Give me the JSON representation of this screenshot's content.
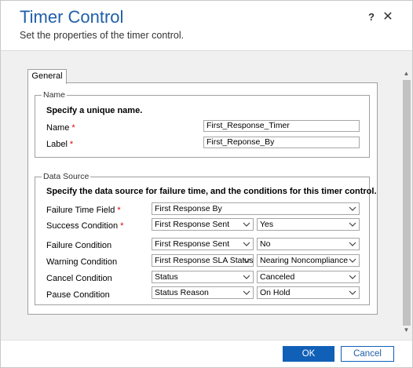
{
  "header": {
    "title": "Timer Control",
    "subtitle": "Set the properties of the timer control.",
    "help_label": "?",
    "close_label": "✕"
  },
  "tabs": [
    {
      "label": "General",
      "selected": true
    }
  ],
  "name_section": {
    "legend": "Name",
    "heading": "Specify a unique name.",
    "fields": [
      {
        "label": "Name",
        "required": "*",
        "value": "First_Response_Timer"
      },
      {
        "label": "Label",
        "required": "*",
        "value": "First_Reponse_By"
      }
    ]
  },
  "data_source": {
    "legend": "Data Source",
    "heading": "Specify the data source for failure time, and the conditions for this timer control.",
    "failure_time_field": {
      "label": "Failure Time Field",
      "required": "*",
      "value": "First Response By"
    },
    "conditions": [
      {
        "label": "Success Condition",
        "required": "*",
        "field": "First Response Sent",
        "value": "Yes"
      },
      {
        "label": "Failure Condition",
        "required": "",
        "field": "First Response Sent",
        "value": "No"
      },
      {
        "label": "Warning Condition",
        "required": "",
        "field": "First Response SLA Status",
        "value": "Nearing Noncompliance"
      },
      {
        "label": "Cancel Condition",
        "required": "",
        "field": "Status",
        "value": "Canceled"
      },
      {
        "label": "Pause Condition",
        "required": "",
        "field": "Status Reason",
        "value": "On Hold"
      }
    ]
  },
  "footer": {
    "ok_label": "OK",
    "cancel_label": "Cancel"
  },
  "colors": {
    "title": "#1f5fa8",
    "primary_button": "#1160b7",
    "required_marker": "#dd0000",
    "background_gray": "#f0f0f0"
  },
  "icons": {
    "dropdown": "chevron-down-icon",
    "close": "close-icon",
    "help": "help-icon"
  }
}
